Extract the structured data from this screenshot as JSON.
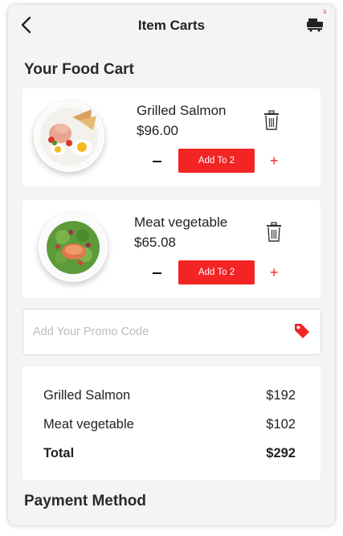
{
  "header": {
    "title": "Item Carts",
    "cart_count": "3"
  },
  "cart_section": {
    "title": "Your Food Cart"
  },
  "items": [
    {
      "name": "Grilled Salmon",
      "price": "$96.00",
      "add_label": "Add To 2",
      "image": "salmon-breakfast-plate"
    },
    {
      "name": "Meat vegetable",
      "price": "$65.08",
      "add_label": "Add To 2",
      "image": "salmon-salad-plate"
    }
  ],
  "promo": {
    "placeholder": "Add Your Promo Code",
    "value": ""
  },
  "summary": {
    "rows": [
      {
        "label": "Grilled Salmon",
        "value": "$192"
      },
      {
        "label": "Meat vegetable",
        "value": "$102"
      }
    ],
    "total": {
      "label": "Total",
      "value": "$292"
    }
  },
  "payment": {
    "title": "Payment Method"
  },
  "icons": {
    "back": "chevron-left-icon",
    "cart": "cart-icon",
    "delete": "trash-icon",
    "decrease": "minus-icon",
    "increase": "plus-icon",
    "promo": "tag-icon"
  },
  "colors": {
    "accent": "#f32424",
    "background": "#f4f4f4",
    "card": "#ffffff"
  }
}
